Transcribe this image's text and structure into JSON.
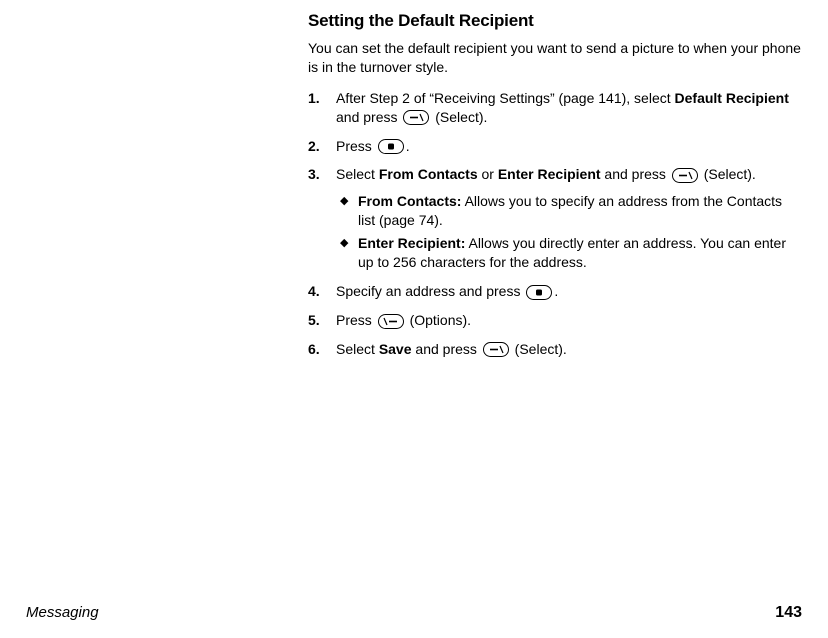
{
  "title": "Setting the Default Recipient",
  "intro": "You can set the default recipient you want to send a picture to when your phone is in the turnover style.",
  "steps": {
    "s1": {
      "num": "1.",
      "t1": "After Step 2 of “Receiving Settings” (page 141), select ",
      "bold1": "Default Recipient",
      "t2": " and press ",
      "t3": " (Select)."
    },
    "s2": {
      "num": "2.",
      "t1": "Press ",
      "t2": "."
    },
    "s3": {
      "num": "3.",
      "t1": "Select ",
      "bold1": "From Contacts",
      "t2": " or ",
      "bold2": "Enter Recipient",
      "t3": " and press ",
      "t4": " (Select).",
      "sub": {
        "a": {
          "bold": "From Contacts:",
          "text": " Allows you to specify an address from the Contacts list (page 74)."
        },
        "b": {
          "bold": "Enter Recipient:",
          "text": " Allows you directly enter an address. You can enter up to 256 characters for the address."
        }
      }
    },
    "s4": {
      "num": "4.",
      "t1": "Specify an address and press ",
      "t2": "."
    },
    "s5": {
      "num": "5.",
      "t1": "Press ",
      "t2": " (Options)."
    },
    "s6": {
      "num": "6.",
      "t1": "Select ",
      "bold1": "Save",
      "t2": " and press ",
      "t3": " (Select)."
    }
  },
  "footer": {
    "category": "Messaging",
    "page": "143"
  },
  "icons": {
    "softkey_left": "softkey-left-icon",
    "softkey_right": "softkey-right-icon",
    "center_key": "center-key-icon"
  }
}
